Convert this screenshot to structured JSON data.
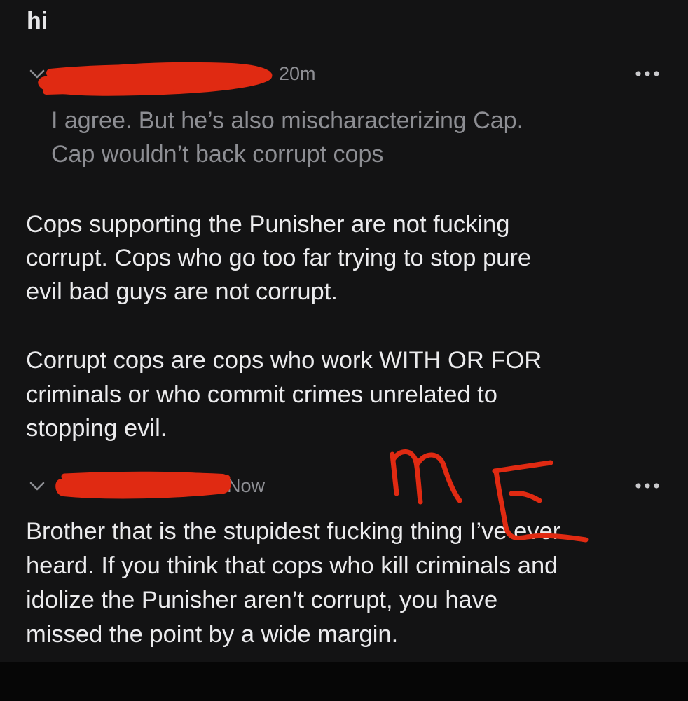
{
  "previous_post": {
    "title_fragment": "hi"
  },
  "comment_1": {
    "username": "",
    "time": "20m",
    "quote_lines": [
      "I agree. But he’s also mischaracterizing Cap.",
      "Cap wouldn’t back corrupt cops"
    ],
    "body_lines": [
      "Cops supporting the Punisher are not fucking",
      "corrupt. Cops who go too far trying to stop pure",
      "evil bad guys are not corrupt.",
      "",
      "Corrupt cops are cops who work WITH OR FOR",
      "criminals or who commit crimes unrelated to",
      "stopping evil."
    ],
    "collapse_icon": "chevron-down-icon",
    "more_icon": "more-horizontal-icon"
  },
  "comment_2": {
    "username": "",
    "time": "Now",
    "body_lines": [
      "Brother that is the stupidest fucking thing I’ve ever",
      "heard. If you think that cops who kill criminals and",
      "idolize the Punisher aren’t corrupt, you have",
      "missed the point by a wide margin."
    ],
    "collapse_icon": "chevron-down-icon",
    "more_icon": "more-horizontal-icon"
  },
  "annotation": {
    "text": "ME",
    "color": "#e02a12"
  },
  "colors": {
    "background": "#131314",
    "bottom_bar": "#060606",
    "body_text": "#ebebed",
    "quote_text": "#8d8e93",
    "meta_text": "#8e8f94",
    "redaction": "#e02a12"
  }
}
